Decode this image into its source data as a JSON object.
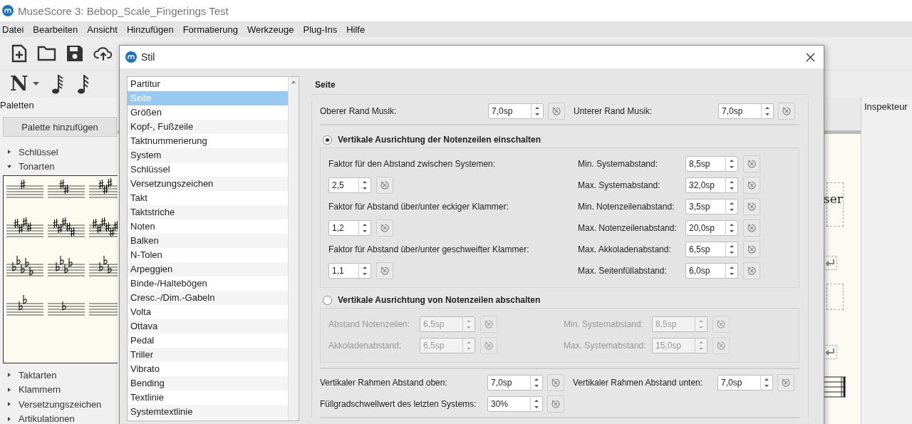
{
  "app_window": {
    "title": "MuseScore 3: Bebop_Scale_Fingerings Test"
  },
  "menu": [
    "Datei",
    "Bearbeiten",
    "Ansicht",
    "Hinzufügen",
    "Formatierung",
    "Werkzeuge",
    "Plug-Ins",
    "Hilfe"
  ],
  "toolbar": {
    "note_input": "N"
  },
  "palettes": {
    "title": "Paletten",
    "add_button": "Palette hinzufügen",
    "groups_top": [
      {
        "label": "Schlüssel",
        "expanded": false
      },
      {
        "label": "Tonarten",
        "expanded": true
      }
    ],
    "groups_bottom": [
      {
        "label": "Taktarten",
        "expanded": false
      },
      {
        "label": "Klammern",
        "expanded": false
      },
      {
        "label": "Versetzungszeichen",
        "expanded": false
      },
      {
        "label": "Artikulationen",
        "expanded": false
      }
    ]
  },
  "score": {
    "text": "ser"
  },
  "inspector": {
    "title": "Inspekteur"
  },
  "dialog": {
    "title": "Stil",
    "categories": [
      {
        "label": "Partitur",
        "selected": false
      },
      {
        "label": "Seite",
        "selected": true
      },
      {
        "label": "Größen",
        "selected": false
      },
      {
        "label": "Kopf-, Fußzeile",
        "selected": false
      },
      {
        "label": "Taktnummerierung",
        "selected": false
      },
      {
        "label": "System",
        "selected": false
      },
      {
        "label": "Schlüssel",
        "selected": false
      },
      {
        "label": "Versetzungszeichen",
        "selected": false
      },
      {
        "label": "Takt",
        "selected": false
      },
      {
        "label": "Taktstriche",
        "selected": false
      },
      {
        "label": "Noten",
        "selected": false
      },
      {
        "label": "Balken",
        "selected": false
      },
      {
        "label": "N-Tolen",
        "selected": false
      },
      {
        "label": "Arpeggien",
        "selected": false
      },
      {
        "label": "Binde-/Haltebögen",
        "selected": false
      },
      {
        "label": "Cresc.-/Dim.-Gabeln",
        "selected": false
      },
      {
        "label": "Volta",
        "selected": false
      },
      {
        "label": "Ottava",
        "selected": false
      },
      {
        "label": "Pedal",
        "selected": false
      },
      {
        "label": "Triller",
        "selected": false
      },
      {
        "label": "Vibrato",
        "selected": false
      },
      {
        "label": "Bending",
        "selected": false
      },
      {
        "label": "Textlinie",
        "selected": false
      },
      {
        "label": "Systemtextlinie",
        "selected": false
      }
    ],
    "section_title": "Seite",
    "margins": [
      {
        "label": "Oberer Rand Musik:",
        "value": "7,0sp"
      },
      {
        "label": "Unterer Rand Musik:",
        "value": "7,0sp"
      }
    ],
    "enable_group": {
      "label": "Vertikale Ausrichtung der Notenzeilen einschalten",
      "selected": true,
      "factors": [
        {
          "label": "Faktor für den Abstand zwischen Systemen:",
          "value": "2,5"
        },
        {
          "label": "Faktor für Abstand über/unter eckiger Klammer:",
          "value": "1,2"
        },
        {
          "label": "Faktor für Abstand über/unter geschweifter Klammer:",
          "value": "1,1"
        }
      ],
      "limits": [
        {
          "label": "Min. Systemabstand:",
          "value": "8,5sp"
        },
        {
          "label": "Max. Systemabstand:",
          "value": "32,0sp"
        },
        {
          "label": "Min. Notenzeilenabstand:",
          "value": "3,5sp"
        },
        {
          "label": "Max. Notenzeilenabstand:",
          "value": "20,0sp"
        },
        {
          "label": "Max. Akkoladenabstand:",
          "value": "6,5sp"
        },
        {
          "label": "Max. Seitenfüllabstand:",
          "value": "6,0sp"
        }
      ]
    },
    "disable_group": {
      "label": "Vertikale Ausrichtung von Notenzeilen abschalten",
      "selected": false,
      "disabled": true,
      "left": [
        {
          "label": "Abstand Notenzeilen:",
          "value": "6,5sp"
        },
        {
          "label": "Akkoladenabstand:",
          "value": "6,5sp"
        }
      ],
      "right": [
        {
          "label": "Min. Systemabstand:",
          "value": "8,5sp"
        },
        {
          "label": "Max. Systemabstand:",
          "value": "15,0sp"
        }
      ]
    },
    "frames": [
      {
        "label": "Vertikaler Rahmen Abstand oben:",
        "value": "7,0sp"
      },
      {
        "label": "Vertikaler Rahmen Abstand unten:",
        "value": "7,0sp"
      }
    ],
    "fill": {
      "label": "Füllgradschwellwert des letzten Systems:",
      "value": "30%"
    }
  }
}
